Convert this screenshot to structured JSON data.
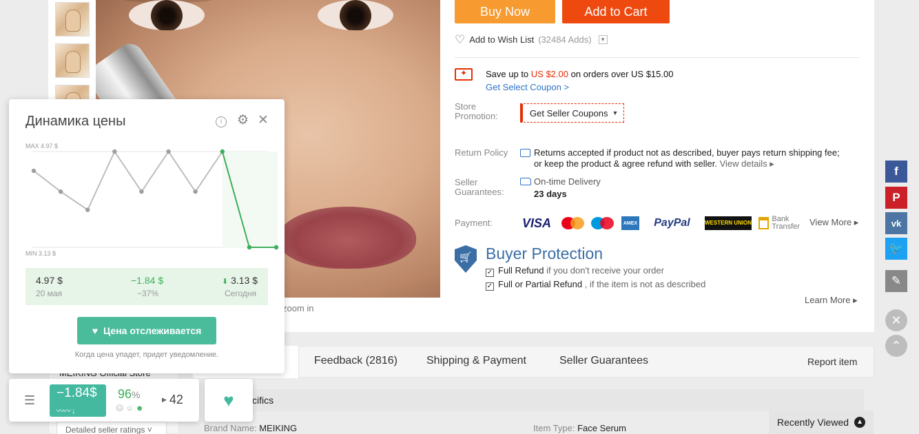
{
  "product": {
    "zoom_hint": "zoom in"
  },
  "actions": {
    "buy_now": "Buy Now",
    "add_to_cart": "Add to Cart",
    "wish_label": "Add to Wish List",
    "wish_count": "(32484 Adds)"
  },
  "promo": {
    "save_prefix": "Save up to ",
    "save_amount": "US $2.00",
    "save_suffix": " on orders over US $15.00",
    "get_coupon_link": "Get Select Coupon >",
    "store_promotion_label": "Store\nPromotion:",
    "seller_coupons_button": "Get Seller Coupons"
  },
  "policy": {
    "return_label": "Return Policy",
    "return_line1": "Returns accepted if product not as described, buyer pays return shipping fee;",
    "return_line2": "or keep the product & agree refund with seller.",
    "view_details": "View details ▸",
    "guarantee_label": "Seller\nGuarantees:",
    "delivery_label": "On-time Delivery",
    "delivery_days": "23 days",
    "payment_label": "Payment:",
    "payment_methods": [
      "VISA",
      "MasterCard",
      "Maestro",
      "AMEX",
      "PayPal",
      "WESTERN UNION",
      "Bank Transfer"
    ],
    "view_more": "View More ▸"
  },
  "buyer_protection": {
    "title": "Buyer Protection",
    "item1_bold": "Full Refund",
    "item1_rest": " if you don't receive your order",
    "item2_bold": "Full or Partial Refund",
    "item2_rest": " , if the item is not as described",
    "learn_more": "Learn More ▸"
  },
  "tabs": {
    "feedback": "Feedback (2816)",
    "shipping": "Shipping & Payment",
    "guarantees": "Seller Guarantees",
    "report": "Report item",
    "specifics": "cifics",
    "brand_label": "Brand Name:",
    "brand_value": "MEIKING",
    "type_label": "Item Type:",
    "type_value": "Face Serum",
    "store_name": "MEIKING Official Store",
    "ratings": "Detailed seller ratings",
    "recently_viewed": "Recently Viewed"
  },
  "social": {
    "icons": [
      "facebook-icon",
      "pinterest-icon",
      "vk-icon",
      "twitter-icon",
      "pencil-icon",
      "close-icon",
      "chevron-up-icon"
    ]
  },
  "price_popup": {
    "title": "Динамика цены",
    "max_label": "MAX 4.97 $",
    "min_label": "MIN 3.13 $",
    "start_price": "4.97 $",
    "start_date": "20 мая",
    "change_abs": "−1.84 $",
    "change_pct": "−37%",
    "current_price": "3.13 $",
    "current_label": "Сегодня",
    "track_button": "Цена отслеживается",
    "notify_text": "Когда цена упадет, придет уведомление.",
    "colors": {
      "history": "#bdbdbd",
      "recent": "#3daf5a",
      "accent": "#4bbc9b"
    }
  },
  "chart_data": {
    "type": "line",
    "title": "Динамика цены",
    "ylim": [
      3.13,
      4.97
    ],
    "series": [
      {
        "values": [
          4.6,
          4.2,
          3.85,
          4.97,
          4.2,
          4.97,
          4.2,
          4.97,
          3.13,
          3.13
        ]
      }
    ],
    "recent_from_index": 7
  },
  "widget": {
    "change": "−1.84$",
    "percent": "96",
    "percent_sign": "%",
    "count": "42"
  }
}
